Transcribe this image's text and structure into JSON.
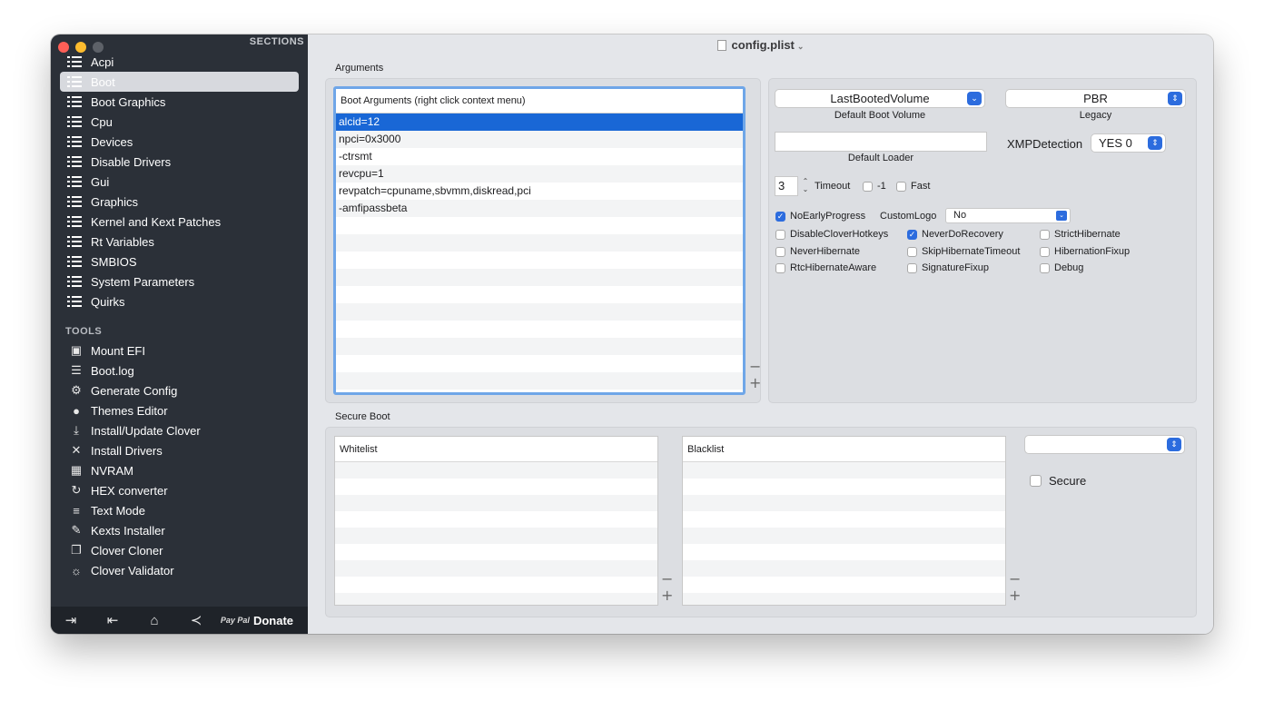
{
  "window": {
    "title": "config.plist"
  },
  "sidebar": {
    "sections_header": "SECTIONS",
    "sections": [
      "Acpi",
      "Boot",
      "Boot Graphics",
      "Cpu",
      "Devices",
      "Disable Drivers",
      "Gui",
      "Graphics",
      "Kernel and Kext Patches",
      "Rt Variables",
      "SMBIOS",
      "System Parameters",
      "Quirks"
    ],
    "selected_section": "Boot",
    "tools_header": "TOOLS",
    "tools": [
      {
        "label": "Mount EFI",
        "icon": "disk-icon"
      },
      {
        "label": "Boot.log",
        "icon": "log-search-icon"
      },
      {
        "label": "Generate Config",
        "icon": "gears-icon"
      },
      {
        "label": "Themes Editor",
        "icon": "palette-icon"
      },
      {
        "label": "Install/Update Clover",
        "icon": "download-icon"
      },
      {
        "label": "Install Drivers",
        "icon": "tools-icon"
      },
      {
        "label": "NVRAM",
        "icon": "chip-icon"
      },
      {
        "label": "HEX converter",
        "icon": "refresh-icon"
      },
      {
        "label": "Text Mode",
        "icon": "text-lines-icon"
      },
      {
        "label": "Kexts Installer",
        "icon": "plug-icon"
      },
      {
        "label": "Clover Cloner",
        "icon": "clone-icon"
      },
      {
        "label": "Clover Validator",
        "icon": "lightbulb-icon"
      }
    ],
    "bottom": {
      "donate_label": "Donate",
      "paypal_text": "Pay Pal"
    }
  },
  "arguments": {
    "section_label": "Arguments",
    "table_header": "Boot Arguments (right click context menu)",
    "rows": [
      "alcid=12",
      "npci=0x3000",
      "-ctrsmt",
      "revcpu=1",
      "revpatch=cpuname,sbvmm,diskread,pci",
      "-amfipassbeta"
    ],
    "selected_row": 0
  },
  "boot_options": {
    "default_volume_value": "LastBootedVolume",
    "default_volume_label": "Default Boot Volume",
    "legacy_value": "PBR",
    "legacy_label": "Legacy",
    "default_loader_value": "",
    "default_loader_label": "Default Loader",
    "xmp_label": "XMPDetection",
    "xmp_value": "YES 0",
    "timeout_value": "3",
    "timeout_label": "Timeout",
    "minus_one_label": "-1",
    "fast_label": "Fast",
    "custom_logo_label": "CustomLogo",
    "custom_logo_value": "No",
    "checkboxes": [
      {
        "label": "NoEarlyProgress",
        "checked": true
      },
      {
        "label": "DisableCloverHotkeys",
        "checked": false
      },
      {
        "label": "NeverDoRecovery",
        "checked": true
      },
      {
        "label": "StrictHibernate",
        "checked": false
      },
      {
        "label": "NeverHibernate",
        "checked": false
      },
      {
        "label": "SkipHibernateTimeout",
        "checked": false
      },
      {
        "label": "HibernationFixup",
        "checked": false
      },
      {
        "label": "RtcHibernateAware",
        "checked": false
      },
      {
        "label": "SignatureFixup",
        "checked": false
      },
      {
        "label": "Debug",
        "checked": false
      }
    ]
  },
  "secure_boot": {
    "section_label": "Secure Boot",
    "whitelist_header": "Whitelist",
    "blacklist_header": "Blacklist",
    "policy_value": "",
    "secure_label": "Secure"
  },
  "colors": {
    "accent": "#2c6cde",
    "sidebar_bg": "#2b3038",
    "selection": "#1967d6"
  }
}
